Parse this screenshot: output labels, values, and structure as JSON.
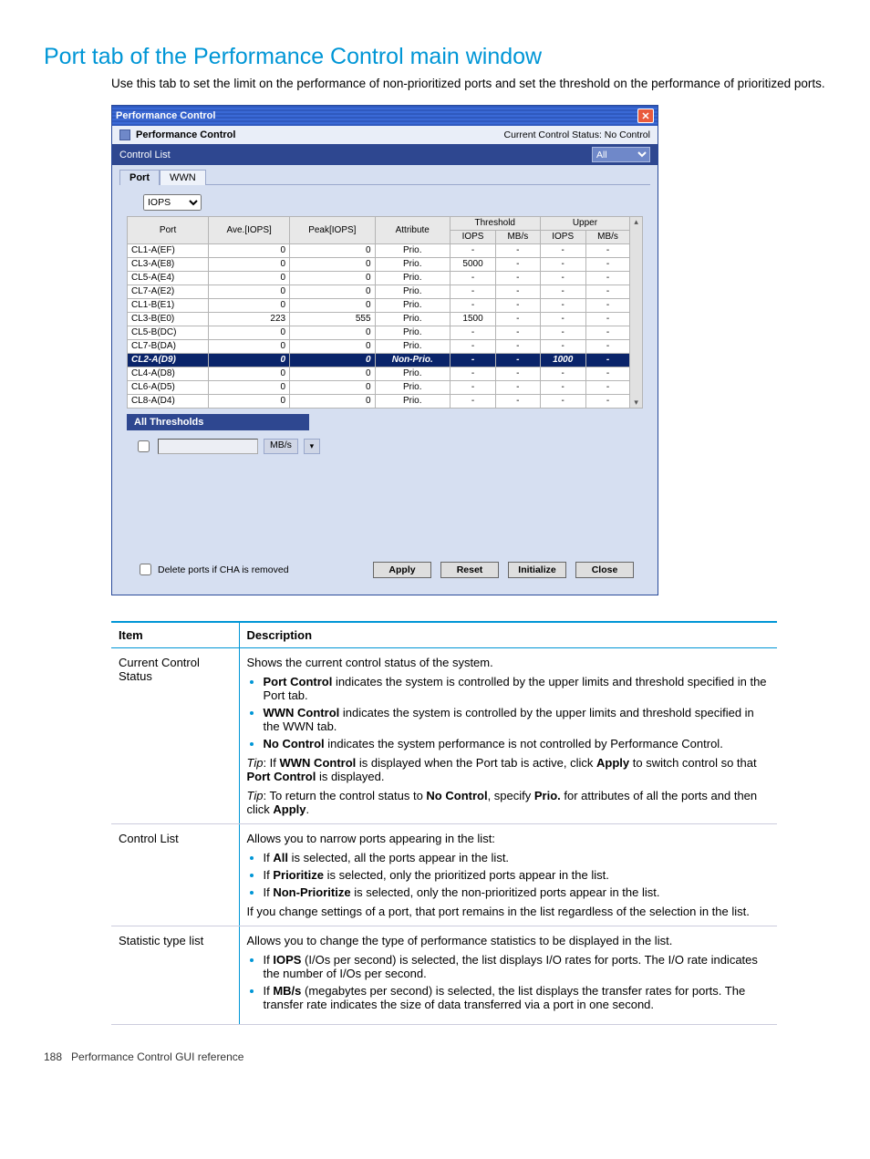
{
  "page": {
    "title": "Port tab of the Performance Control main window",
    "intro": "Use this tab to set the limit on the performance of non-prioritized ports and set the threshold on the performance of prioritized ports.",
    "footer_page": "188",
    "footer_text": "Performance Control GUI reference"
  },
  "panel": {
    "window_title": "Performance Control",
    "section_title": "Performance Control",
    "status_label": "Current Control Status:",
    "status_value": "No Control",
    "control_list_label": "Control List",
    "control_list_value": "All",
    "tabs": {
      "port": "Port",
      "wwn": "WWN"
    },
    "stat_type": "IOPS",
    "columns": {
      "port": "Port",
      "ave": "Ave.[IOPS]",
      "peak": "Peak[IOPS]",
      "attr": "Attribute",
      "threshold": "Threshold",
      "upper": "Upper",
      "iops": "IOPS",
      "mbs": "MB/s"
    },
    "rows": [
      {
        "port": "CL1-A(EF)",
        "ave": "0",
        "peak": "0",
        "attr": "Prio.",
        "t_iops": "-",
        "t_mbs": "-",
        "u_iops": "-",
        "u_mbs": "-"
      },
      {
        "port": "CL3-A(E8)",
        "ave": "0",
        "peak": "0",
        "attr": "Prio.",
        "t_iops": "5000",
        "t_mbs": "-",
        "u_iops": "-",
        "u_mbs": "-"
      },
      {
        "port": "CL5-A(E4)",
        "ave": "0",
        "peak": "0",
        "attr": "Prio.",
        "t_iops": "-",
        "t_mbs": "-",
        "u_iops": "-",
        "u_mbs": "-"
      },
      {
        "port": "CL7-A(E2)",
        "ave": "0",
        "peak": "0",
        "attr": "Prio.",
        "t_iops": "-",
        "t_mbs": "-",
        "u_iops": "-",
        "u_mbs": "-"
      },
      {
        "port": "CL1-B(E1)",
        "ave": "0",
        "peak": "0",
        "attr": "Prio.",
        "t_iops": "-",
        "t_mbs": "-",
        "u_iops": "-",
        "u_mbs": "-"
      },
      {
        "port": "CL3-B(E0)",
        "ave": "223",
        "peak": "555",
        "attr": "Prio.",
        "t_iops": "1500",
        "t_mbs": "-",
        "u_iops": "-",
        "u_mbs": "-"
      },
      {
        "port": "CL5-B(DC)",
        "ave": "0",
        "peak": "0",
        "attr": "Prio.",
        "t_iops": "-",
        "t_mbs": "-",
        "u_iops": "-",
        "u_mbs": "-"
      },
      {
        "port": "CL7-B(DA)",
        "ave": "0",
        "peak": "0",
        "attr": "Prio.",
        "t_iops": "-",
        "t_mbs": "-",
        "u_iops": "-",
        "u_mbs": "-"
      },
      {
        "port": "CL2-A(D9)",
        "ave": "0",
        "peak": "0",
        "attr": "Non-Prio.",
        "t_iops": "-",
        "t_mbs": "-",
        "u_iops": "1000",
        "u_mbs": "-",
        "selected": true
      },
      {
        "port": "CL4-A(D8)",
        "ave": "0",
        "peak": "0",
        "attr": "Prio.",
        "t_iops": "-",
        "t_mbs": "-",
        "u_iops": "-",
        "u_mbs": "-"
      },
      {
        "port": "CL6-A(D5)",
        "ave": "0",
        "peak": "0",
        "attr": "Prio.",
        "t_iops": "-",
        "t_mbs": "-",
        "u_iops": "-",
        "u_mbs": "-"
      },
      {
        "port": "CL8-A(D4)",
        "ave": "0",
        "peak": "0",
        "attr": "Prio.",
        "t_iops": "-",
        "t_mbs": "-",
        "u_iops": "-",
        "u_mbs": "-"
      }
    ],
    "all_thresholds_label": "All Thresholds",
    "unit_label": "MB/s",
    "delete_label": "Delete ports if CHA is removed",
    "buttons": {
      "apply": "Apply",
      "reset": "Reset",
      "initialize": "Initialize",
      "close": "Close"
    }
  },
  "desc": {
    "head_item": "Item",
    "head_desc": "Description",
    "r1_item": "Current Control Status",
    "r1_p1": "Shows the current control status of the system.",
    "r1_b1a": "Port Control",
    "r1_b1b": " indicates the system is controlled by the upper limits and threshold specified in the Port tab.",
    "r1_b2a": "WWN Control",
    "r1_b2b": " indicates the system is controlled by the upper limits and threshold specified in the WWN tab.",
    "r1_b3a": "No Control",
    "r1_b3b": " indicates the system performance is not controlled by Performance Control.",
    "r1_tip1_pre": "Tip",
    "r1_tip1_a": ": If ",
    "r1_tip1_b": "WWN Control",
    "r1_tip1_c": " is displayed when the Port tab is active, click ",
    "r1_tip1_d": "Apply",
    "r1_tip1_e": " to switch control so that ",
    "r1_tip1_f": "Port Control",
    "r1_tip1_g": " is displayed.",
    "r1_tip2_pre": "Tip",
    "r1_tip2_a": ": To return the control status to ",
    "r1_tip2_b": "No Control",
    "r1_tip2_c": ", specify ",
    "r1_tip2_d": "Prio.",
    "r1_tip2_e": " for attributes of all the ports and then click ",
    "r1_tip2_f": "Apply",
    "r1_tip2_g": ".",
    "r2_item": "Control List",
    "r2_p1": "Allows you to narrow ports appearing in the list:",
    "r2_b1a": "If ",
    "r2_b1b": "All",
    "r2_b1c": " is selected, all the ports appear in the list.",
    "r2_b2a": "If ",
    "r2_b2b": "Prioritize",
    "r2_b2c": " is selected, only the prioritized ports appear in the list.",
    "r2_b3a": "If ",
    "r2_b3b": "Non-Prioritize",
    "r2_b3c": " is selected, only the non-prioritized ports appear in the list.",
    "r2_p2": "If you change settings of a port, that port remains in the list regardless of the selection in the list.",
    "r3_item": "Statistic type list",
    "r3_p1": "Allows you to change the type of performance statistics to be displayed in the list.",
    "r3_b1a": "If ",
    "r3_b1b": "IOPS",
    "r3_b1c": " (I/Os per second) is selected, the list displays I/O rates for ports. The I/O rate indicates the number of I/Os per second.",
    "r3_b2a": "If ",
    "r3_b2b": "MB/s",
    "r3_b2c": " (megabytes per second) is selected, the list displays the transfer rates for ports. The transfer rate indicates the size of data transferred via a port in one second."
  }
}
